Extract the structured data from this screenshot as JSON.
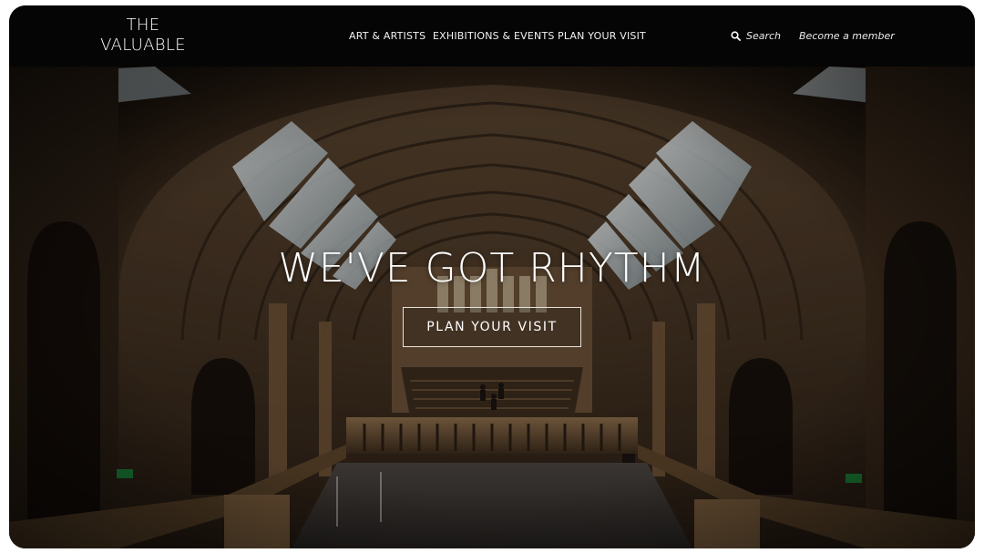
{
  "brand": {
    "line1": "THE",
    "line2": "VALUABLE"
  },
  "nav": {
    "items": [
      {
        "label": "ART & ARTISTS"
      },
      {
        "label": "EXHIBITIONS & EVENTS"
      },
      {
        "label": "PLAN YOUR VISIT"
      }
    ],
    "search_label": "Search",
    "member_label": "Become a member"
  },
  "hero": {
    "title": "WE'VE GOT RHYTHM",
    "cta_label": "PLAN YOUR VISIT",
    "image": "museum-great-hall"
  },
  "colors": {
    "nav_bg": "#050505",
    "text": "#ffffff",
    "stone": "#6b5237",
    "shadow": "#1a120c",
    "skylight": "#c9d3d6"
  }
}
